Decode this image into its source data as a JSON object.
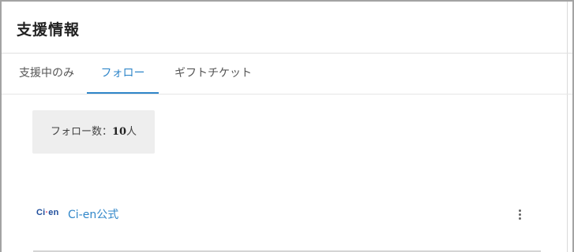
{
  "page": {
    "title": "支援情報"
  },
  "tabs": [
    {
      "label": "支援中のみ",
      "active": false
    },
    {
      "label": "フォロー",
      "active": true
    },
    {
      "label": "ギフトチケット",
      "active": false
    }
  ],
  "follow_count": {
    "label": "フォロー数：",
    "value": "10",
    "unit": "人"
  },
  "list": [
    {
      "logo_main": "Ci",
      "logo_dot": "·",
      "logo_tail": "en",
      "name": "Ci-en公式",
      "menu_icon": "more-vertical-icon"
    }
  ],
  "colors": {
    "accent": "#2f86c9",
    "logo_blue": "#1f4e9c",
    "logo_pink": "#e2466a",
    "box_bg": "#eeeeee"
  }
}
